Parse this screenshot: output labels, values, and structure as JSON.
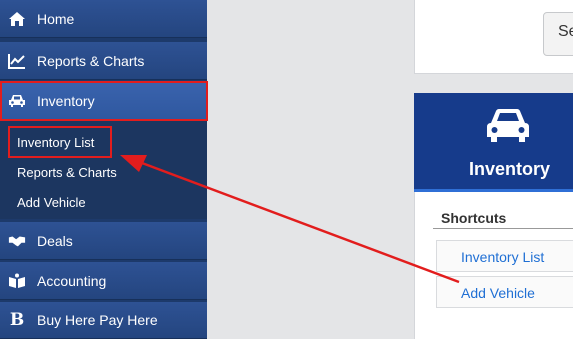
{
  "sidebar": {
    "items": [
      {
        "label": "Home",
        "icon": "home-icon"
      },
      {
        "label": "Reports & Charts",
        "icon": "line-chart-icon"
      },
      {
        "label": "Inventory",
        "icon": "car-icon"
      },
      {
        "label": "Deals",
        "icon": "handshake-icon"
      },
      {
        "label": "Accounting",
        "icon": "ledger-icon"
      },
      {
        "label": "Buy Here Pay Here",
        "icon": "b-letter-icon"
      }
    ],
    "submenu": [
      "Inventory List",
      "Reports & Charts",
      "Add Vehicle"
    ]
  },
  "top_button": {
    "label": "Se"
  },
  "panel": {
    "title": "Inventory",
    "icon": "car-icon",
    "shortcuts_label": "Shortcuts",
    "shortcuts": [
      "Inventory List",
      "Add Vehicle"
    ]
  },
  "colors": {
    "sidebar_bg": "#24457f",
    "panel_header": "#163b8b",
    "link": "#1f6fd4",
    "annotation_red": "#e21d1d"
  }
}
